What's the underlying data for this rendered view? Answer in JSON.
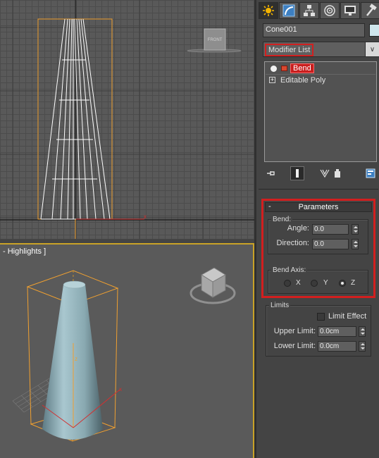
{
  "viewports": {
    "persp_label": "- Highlights ]",
    "viewcube_front_label": "FRONT"
  },
  "panel": {
    "tabs": [
      {
        "icon": "create-icon",
        "active": true
      },
      {
        "icon": "modify-icon",
        "active": false
      },
      {
        "icon": "hierarchy-icon",
        "active": false
      },
      {
        "icon": "motion-icon",
        "active": false
      },
      {
        "icon": "display-icon",
        "active": false
      },
      {
        "icon": "utilities-icon",
        "active": false
      }
    ],
    "object_name": "Cone001",
    "object_color": "#cfe6ec",
    "modifier_list_label": "Modifier List",
    "stack": [
      {
        "label": "Bend",
        "selected": true
      },
      {
        "label": "Editable Poly",
        "selected": false
      }
    ],
    "toolbar_icons": [
      "pin-stack-icon",
      "show-end-result-icon",
      "make-unique-icon",
      "remove-modifier-icon",
      "configure-modifier-sets-icon"
    ]
  },
  "parameters": {
    "title": "Parameters",
    "bend_group": "Bend:",
    "angle_label": "Angle:",
    "angle_value": "0.0",
    "direction_label": "Direction:",
    "direction_value": "0.0",
    "bend_axis_group": "Bend Axis:",
    "axis_x": "X",
    "axis_y": "Y",
    "axis_z": "Z",
    "selected_axis": "Z",
    "limits_group": "Limits",
    "limit_effect_label": "Limit Effect",
    "limit_effect_checked": false,
    "upper_label": "Upper Limit:",
    "upper_value": "0.0cm",
    "lower_label": "Lower Limit:",
    "lower_value": "0.0cm"
  },
  "colors": {
    "highlight": "#d21f1f",
    "selection_box": "#f0a030",
    "viewport_bg": "#595959"
  }
}
